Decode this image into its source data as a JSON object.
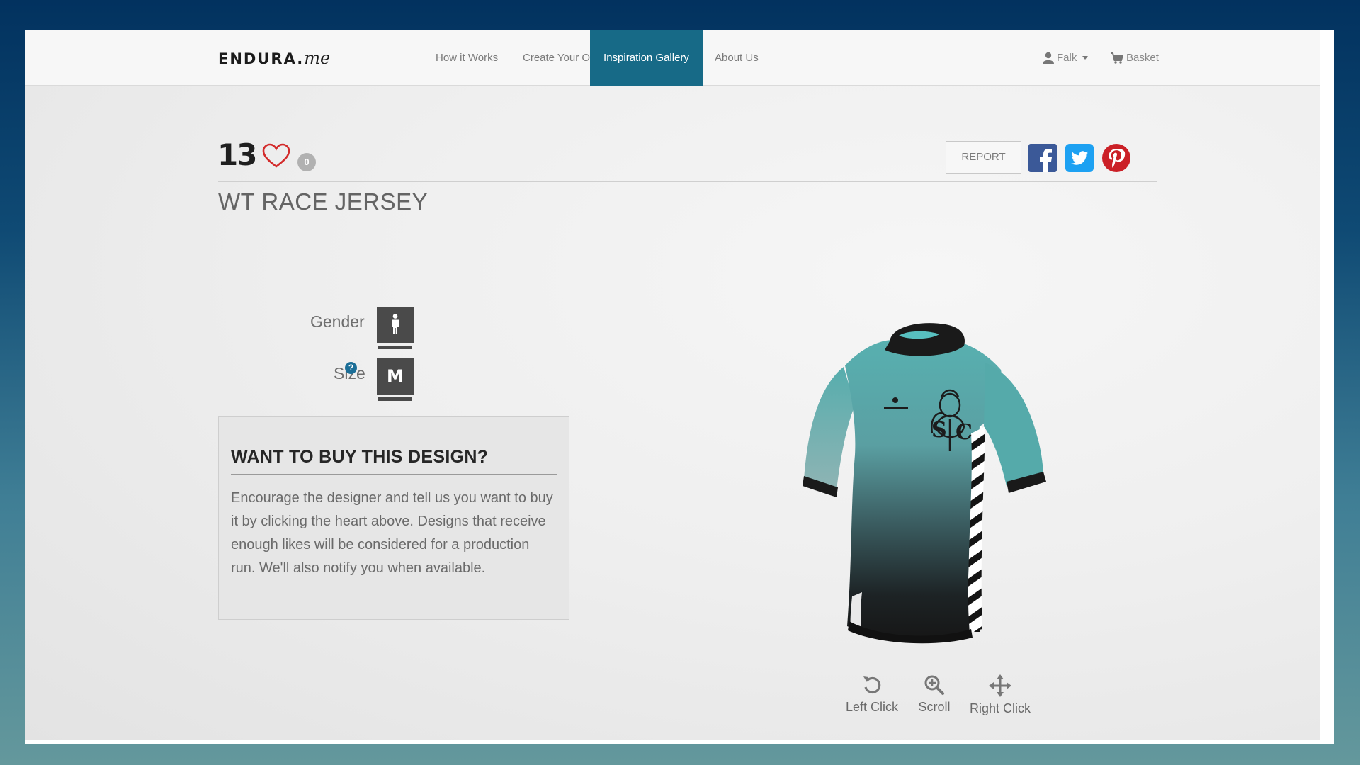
{
  "brand": {
    "logo_main": "ENDURA.",
    "logo_suffix": "me"
  },
  "nav": {
    "items": [
      {
        "label": "How it Works",
        "active": false
      },
      {
        "label": "Create Your Own",
        "active": false
      },
      {
        "label": "Inspiration Gallery",
        "active": true
      },
      {
        "label": "About Us",
        "active": false
      }
    ],
    "user_label": "Falk",
    "basket_label": "Basket",
    "active_color": "#176a87"
  },
  "design": {
    "likes": "13",
    "comments": "0",
    "title": "WT RACE JERSEY",
    "report_label": "REPORT"
  },
  "social": {
    "facebook_color": "#3b5998",
    "twitter_color": "#1da1f2",
    "pinterest_color": "#cb2027"
  },
  "options": {
    "gender_label": "Gender",
    "size_label": "Size",
    "size_value": "M",
    "help_glyph": "?"
  },
  "buy": {
    "title": "WANT TO BUY THIS DESIGN?",
    "text": "Encourage the designer and tell us you want to buy it by clicking the heart above. Designs that receive enough likes will be considered for a production run. We'll also notify you when available."
  },
  "controls": [
    {
      "icon": "rotate-icon",
      "label": "Left Click"
    },
    {
      "icon": "zoom-icon",
      "label": "Scroll"
    },
    {
      "icon": "move-icon",
      "label": "Right Click"
    }
  ],
  "jersey": {
    "main_color": "#57a9a9",
    "dark_color": "#1a1a1a"
  }
}
